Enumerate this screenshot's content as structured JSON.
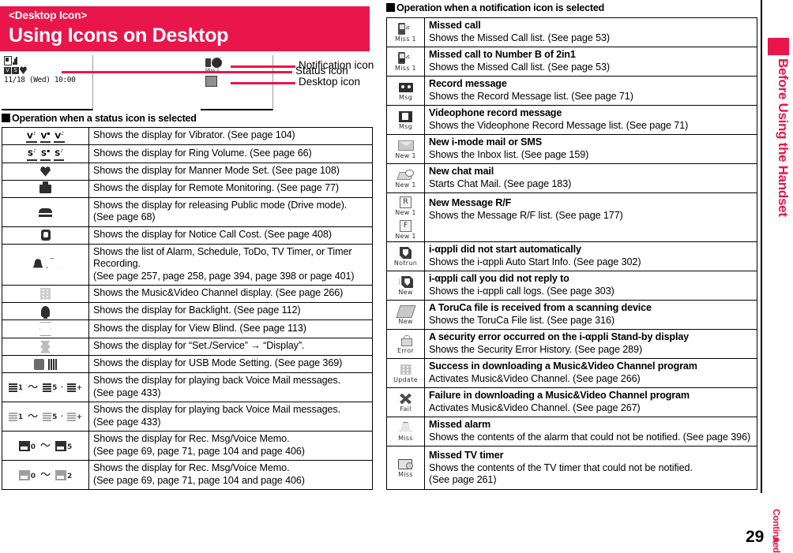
{
  "header": {
    "kicker": "<Desktop Icon>",
    "title": "Using Icons on Desktop",
    "accent_color": "#E8164A"
  },
  "mockups": {
    "phone_clock": "11/18 (Wed) 10:00",
    "notif_caption_1": "Miss 1",
    "callouts": [
      {
        "label": "Status icon"
      },
      {
        "label": "Notification icon"
      },
      {
        "label": "Desktop icon"
      }
    ]
  },
  "sections": {
    "status_heading": "Operation when a status icon is selected",
    "notification_heading": "Operation when a notification icon is selected"
  },
  "status_table": {
    "rows": [
      {
        "icon": "vibrator",
        "lines": [
          "Shows the display for Vibrator. (See page 104)"
        ]
      },
      {
        "icon": "ring-volume",
        "lines": [
          "Shows the display for Ring Volume. (See page 66)"
        ]
      },
      {
        "icon": "manner-mode",
        "lines": [
          "Shows the display for Manner Mode Set. (See page 108)"
        ]
      },
      {
        "icon": "remote-monitoring",
        "lines": [
          "Shows the display for Remote Monitoring. (See page 77)"
        ]
      },
      {
        "icon": "public-drive-mode",
        "lines": [
          "Shows the display for releasing Public mode (Drive mode).",
          "(See page 68)"
        ]
      },
      {
        "icon": "notice-call-cost",
        "lines": [
          "Shows the display for Notice Call Cost. (See page 408)"
        ]
      },
      {
        "icon": "alarm-bell",
        "lines": [
          "Shows the list of Alarm, Schedule, ToDo, TV Timer, or Timer Recording.",
          "(See page 257, page 258, page 394, page 398 or page 401)"
        ]
      },
      {
        "icon": "music-video-channel",
        "lines": [
          "Shows the Music&Video Channel display. (See page 266)"
        ]
      },
      {
        "icon": "backlight",
        "lines": [
          "Shows the display for Backlight. (See page 112)"
        ]
      },
      {
        "icon": "view-blind",
        "lines": [
          "Shows the display for View Blind. (See page 113)"
        ]
      },
      {
        "icon": "set-service-display",
        "lines": [
          "Shows the display for “Set./Service” → “Display”."
        ]
      },
      {
        "icon": "usb-mode-setting",
        "lines": [
          "Shows the display for USB Mode Setting. (See page 369)"
        ]
      },
      {
        "icon": "voice-mail-dark",
        "lines": [
          "Shows the display for playing back Voice Mail messages.",
          "(See page 433)"
        ]
      },
      {
        "icon": "voice-mail-light",
        "lines": [
          "Shows the display for playing back Voice Mail messages.",
          "(See page 433)"
        ]
      },
      {
        "icon": "rec-msg-dark",
        "lines": [
          "Shows the display for Rec. Msg/Voice Memo.",
          "(See page 69, page 71, page 104 and page 406)"
        ]
      },
      {
        "icon": "rec-msg-light",
        "lines": [
          "Shows the display for Rec. Msg/Voice Memo.",
          "(See page 69, page 71, page 104 and page 406)"
        ]
      }
    ]
  },
  "notification_table": {
    "rows": [
      {
        "icon": "missed-call",
        "caption": "Miss 1",
        "title": "Missed call",
        "lines": [
          "Shows the Missed Call list. (See page 53)"
        ]
      },
      {
        "icon": "missed-call-2in1",
        "caption": "Miss 1",
        "title": "Missed call to Number B of 2in1",
        "lines": [
          "Shows the Missed Call list. (See page 53)"
        ]
      },
      {
        "icon": "record-message",
        "caption": "Msg",
        "title": "Record message",
        "lines": [
          "Shows the Record Message list. (See page 71)"
        ]
      },
      {
        "icon": "videophone-record-message",
        "caption": "Msg",
        "title": "Videophone record message",
        "lines": [
          "Shows the Videophone Record Message list. (See page 71)"
        ]
      },
      {
        "icon": "new-mail",
        "caption": "New 1",
        "title": "New i-mode mail or SMS",
        "lines": [
          "Shows the Inbox list. (See page 159)"
        ]
      },
      {
        "icon": "new-chat-mail",
        "caption": "New 1",
        "title": "New chat mail",
        "lines": [
          "Starts Chat Mail. (See page 183)"
        ]
      },
      {
        "icon": "new-message-rf",
        "caption": "New 1",
        "caption2": "New 1",
        "badge1": "R",
        "badge2": "F",
        "title": "New Message R/F",
        "lines": [
          "Shows the Message R/F list. (See page 177)"
        ]
      },
      {
        "icon": "iappli-not-started",
        "caption": "Notrun",
        "title": "i-αppli did not start automatically",
        "lines": [
          "Shows the i-αppli Auto Start Info. (See page 302)"
        ]
      },
      {
        "icon": "iappli-call-unanswered",
        "caption": "New",
        "title": "i-αppli call you did not reply to",
        "lines": [
          "Shows the i-αppli call logs. (See page 303)"
        ]
      },
      {
        "icon": "toruca-received",
        "caption": "New",
        "title": "A ToruCa file is received from a scanning device",
        "lines": [
          "Shows the ToruCa File list. (See page 316)"
        ]
      },
      {
        "icon": "security-error",
        "caption": "Error",
        "title": "A security error occurred on the i-αppli Stand-by display",
        "lines": [
          "Shows the Security Error History. (See page 289)"
        ]
      },
      {
        "icon": "download-success",
        "caption": "Update",
        "title": "Success in downloading a Music&Video Channel program",
        "lines": [
          "Activates Music&Video Channel. (See page 266)"
        ]
      },
      {
        "icon": "download-failure",
        "caption": "Fail",
        "title": "Failure in downloading a Music&Video Channel program",
        "lines": [
          "Activates Music&Video Channel. (See page 267)"
        ]
      },
      {
        "icon": "missed-alarm",
        "caption": "Miss",
        "title": "Missed alarm",
        "lines": [
          "Shows the contents of the alarm that could not be notified. (See page 396)"
        ]
      },
      {
        "icon": "missed-tv-timer",
        "caption": "Miss",
        "title": "Missed TV timer",
        "lines": [
          "Shows the contents of the TV timer that could not be notified.",
          "(See page 261)"
        ]
      }
    ]
  },
  "sidebar": {
    "text": "Before Using the Handset"
  },
  "footer": {
    "page_number": "29",
    "continued": "Continued",
    "continued_arrow": "⬋"
  }
}
